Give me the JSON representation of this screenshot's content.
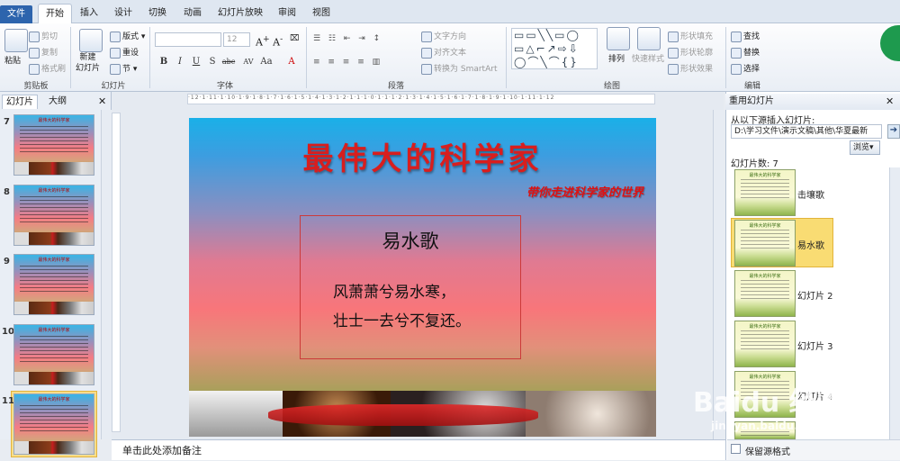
{
  "tabs": {
    "file": "文件",
    "items": [
      "开始",
      "插入",
      "设计",
      "切换",
      "动画",
      "幻灯片放映",
      "审阅",
      "视图"
    ]
  },
  "ribbon": {
    "clipboard": {
      "paste": "粘贴",
      "cut": "剪切",
      "copy": "复制",
      "format_painter": "格式刷",
      "label": "剪贴板"
    },
    "slides": {
      "new_slide": "新建\n幻灯片",
      "layout": "版式",
      "reset": "重设",
      "section": "节",
      "label": "幻灯片"
    },
    "font": {
      "size": "12",
      "label": "字体",
      "bold": "B",
      "italic": "I",
      "underline": "U",
      "strike": "S",
      "shadow": "abc",
      "spacing": "AV",
      "case": "Aa",
      "color": "A"
    },
    "paragraph": {
      "text_direction": "文字方向",
      "align_text": "对齐文本",
      "smartart": "转换为 SmartArt",
      "label": "段落"
    },
    "drawing": {
      "arrange": "排列",
      "quick_styles": "快速样式",
      "fill": "形状填充",
      "outline": "形状轮廓",
      "effects": "形状效果",
      "label": "绘图"
    },
    "editing": {
      "find": "查找",
      "replace": "替换",
      "select": "选择",
      "label": "编辑"
    }
  },
  "left_pane": {
    "tab_slides": "幻灯片",
    "tab_outline": "大纲",
    "slides": [
      {
        "num": "7",
        "title": "最伟大的科学家"
      },
      {
        "num": "8",
        "title": "最伟大的科学家"
      },
      {
        "num": "9",
        "title": "最伟大的科学家"
      },
      {
        "num": "10",
        "title": "最伟大的科学家"
      },
      {
        "num": "11",
        "title": "最伟大的科学家"
      }
    ]
  },
  "slide": {
    "title": "最伟大的科学家",
    "subtitle": "带你走进科学家的世界",
    "poem_title": "易水歌",
    "line1": "风萧萧兮易水寒，",
    "line2": "壮士一去兮不复还。"
  },
  "notes": {
    "placeholder": "单击此处添加备注"
  },
  "reuse": {
    "title": "重用幻灯片",
    "insert_from": "从以下源插入幻灯片:",
    "path": "D:\\学习文件\\演示文稿\\其他\\华夏最新",
    "browse": "浏览",
    "count": "幻灯片数: 7",
    "slides": [
      {
        "label": "击壤歌"
      },
      {
        "label": "易水歌"
      },
      {
        "label": "幻灯片 2"
      },
      {
        "label": "幻灯片 3"
      },
      {
        "label": "幻灯片 4"
      }
    ],
    "keep_format": "保留源格式"
  },
  "watermark": {
    "brand": "Baidu 经验",
    "url": "jingyan.baidu.com"
  }
}
